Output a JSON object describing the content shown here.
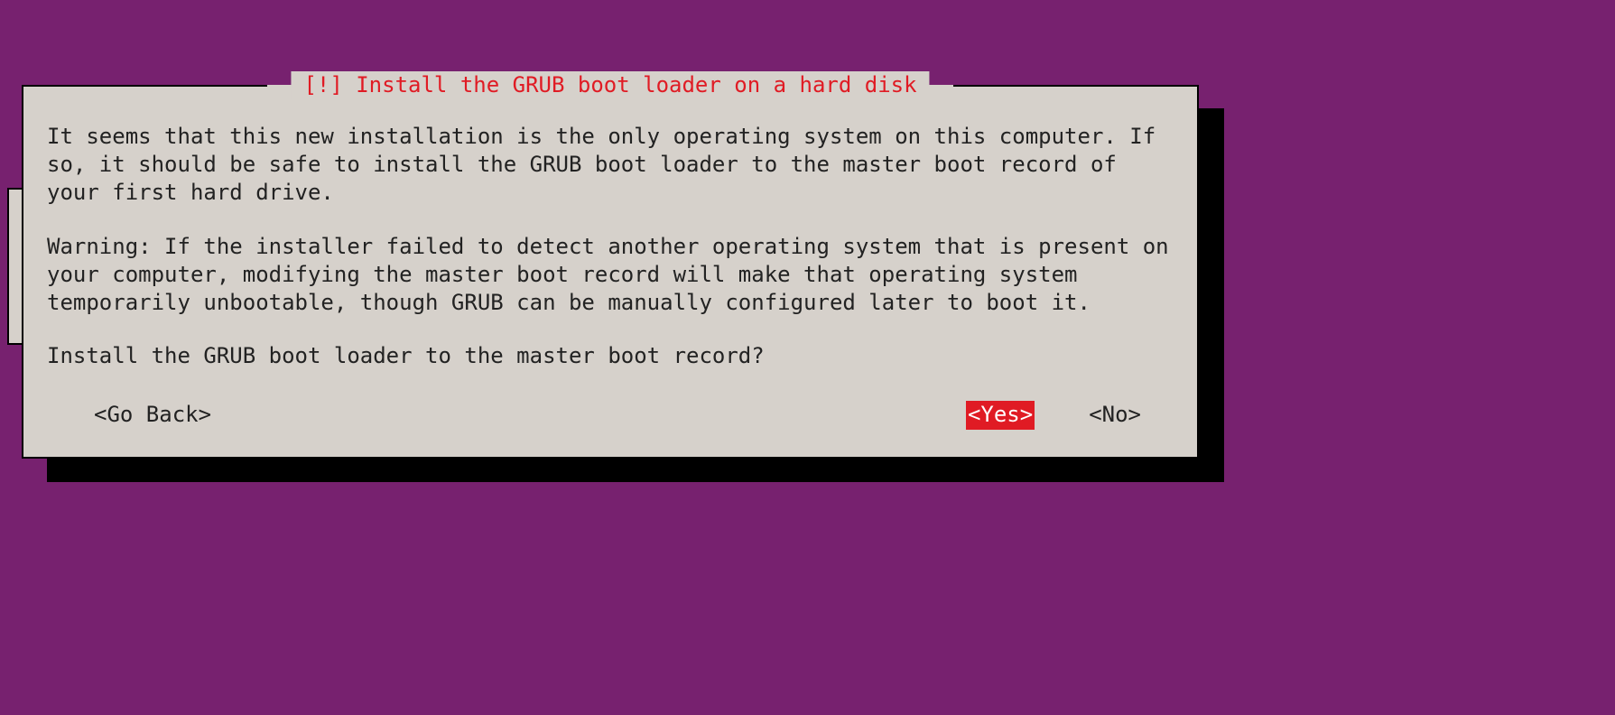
{
  "colors": {
    "background": "#77216f",
    "dialog_bg": "#d6d1cb",
    "dialog_border": "#000000",
    "title_fg": "#e01b24",
    "highlight_bg": "#e01b24",
    "highlight_fg": "#ffffff",
    "shadow": "#000000"
  },
  "dialog": {
    "title": "[!] Install the GRUB boot loader on a hard disk",
    "paragraphs": {
      "p1": "It seems that this new installation is the only operating system on this computer. If so, it should be safe to install the GRUB boot loader to the master boot record of your first hard drive.",
      "p2": "Warning: If the installer failed to detect another operating system that is present on your computer, modifying the master boot record will make that operating system temporarily unbootable, though GRUB can be manually configured later to boot it.",
      "p3": "Install the GRUB boot loader to the master boot record?"
    },
    "buttons": {
      "go_back": "<Go Back>",
      "yes": "<Yes>",
      "no": "<No>",
      "selected": "yes"
    }
  }
}
